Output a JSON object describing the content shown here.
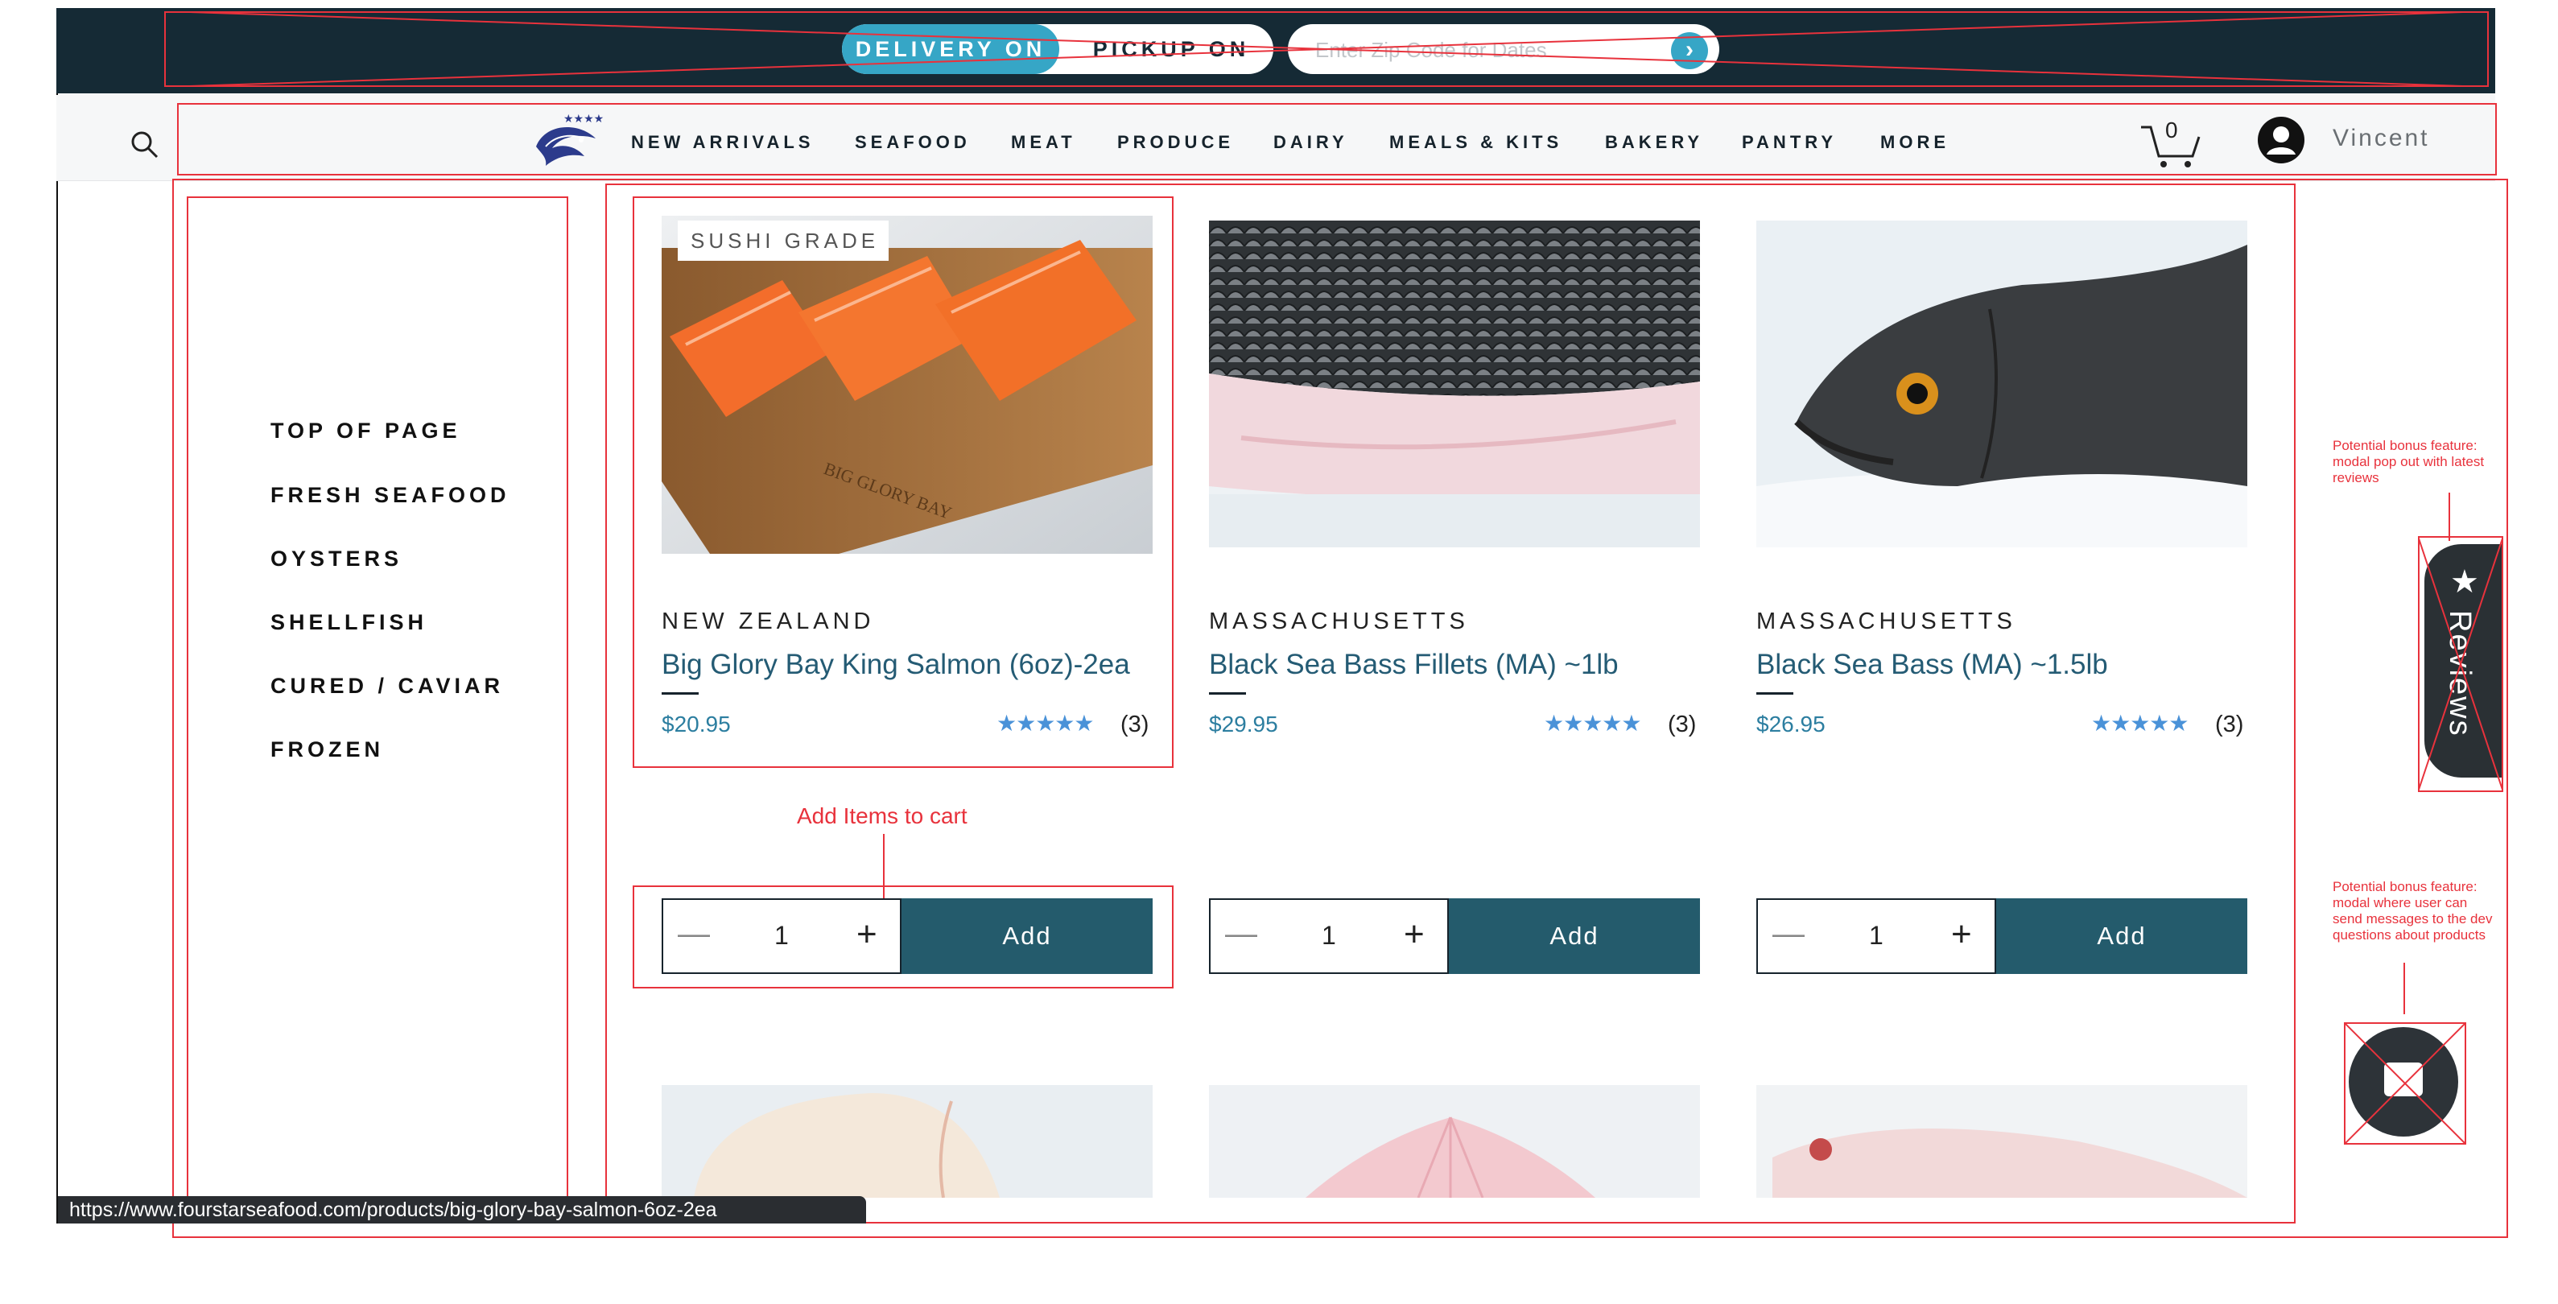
{
  "header": {
    "delivery_label": "DELIVERY ON",
    "pickup_label": "PICKUP ON",
    "zip_placeholder": "Enter Zip Code for Dates",
    "zip_value": ""
  },
  "nav": {
    "items": [
      "NEW ARRIVALS",
      "SEAFOOD",
      "MEAT",
      "PRODUCE",
      "DAIRY",
      "MEALS & KITS",
      "BAKERY",
      "PANTRY",
      "MORE"
    ],
    "cart_count": "0",
    "user_name": "Vincent"
  },
  "sidebar": {
    "items": [
      "TOP OF PAGE",
      "FRESH SEAFOOD",
      "OYSTERS",
      "SHELLFISH",
      "CURED / CAVIAR",
      "FROZEN"
    ]
  },
  "products": [
    {
      "badge": "SUSHI GRADE",
      "origin": "NEW ZEALAND",
      "name": "Big Glory Bay King Salmon (6oz)-2ea",
      "price": "$20.95",
      "stars": "★★★★★",
      "rating": 5,
      "reviews": "(3)",
      "qty": "1",
      "add_label": "Add"
    },
    {
      "badge": "",
      "origin": "MASSACHUSETTS",
      "name": "Black Sea Bass Fillets (MA) ~1lb",
      "price": "$29.95",
      "stars": "★★★★★",
      "rating": 5,
      "reviews": "(3)",
      "qty": "1",
      "add_label": "Add"
    },
    {
      "badge": "",
      "origin": "MASSACHUSETTS",
      "name": "Black Sea Bass (MA) ~1.5lb",
      "price": "$26.95",
      "stars": "★★★★★",
      "rating": 5,
      "reviews": "(3)",
      "qty": "1",
      "add_label": "Add"
    }
  ],
  "qty_controls": {
    "minus": "—",
    "plus": "+"
  },
  "annotations": {
    "add_to_cart": "Add Items to cart",
    "reviews_note": "Potential bonus feature:  modal pop out with latest reviews",
    "chat_note": "Potential bonus feature: modal where user can send messages to the dev questions about products"
  },
  "reviews_tab": {
    "label": "Reviews",
    "icon": "star-icon"
  },
  "chat": {
    "icon": "message-icon"
  },
  "statusbar": {
    "url": "https://www.fourstarseafood.com/products/big-glory-bay-salmon-6oz-2ea"
  },
  "colors": {
    "header_bg": "#152a35",
    "accent": "#36a6c6",
    "button": "#245b6c",
    "link": "#245b74",
    "annotation": "#e8323c"
  }
}
